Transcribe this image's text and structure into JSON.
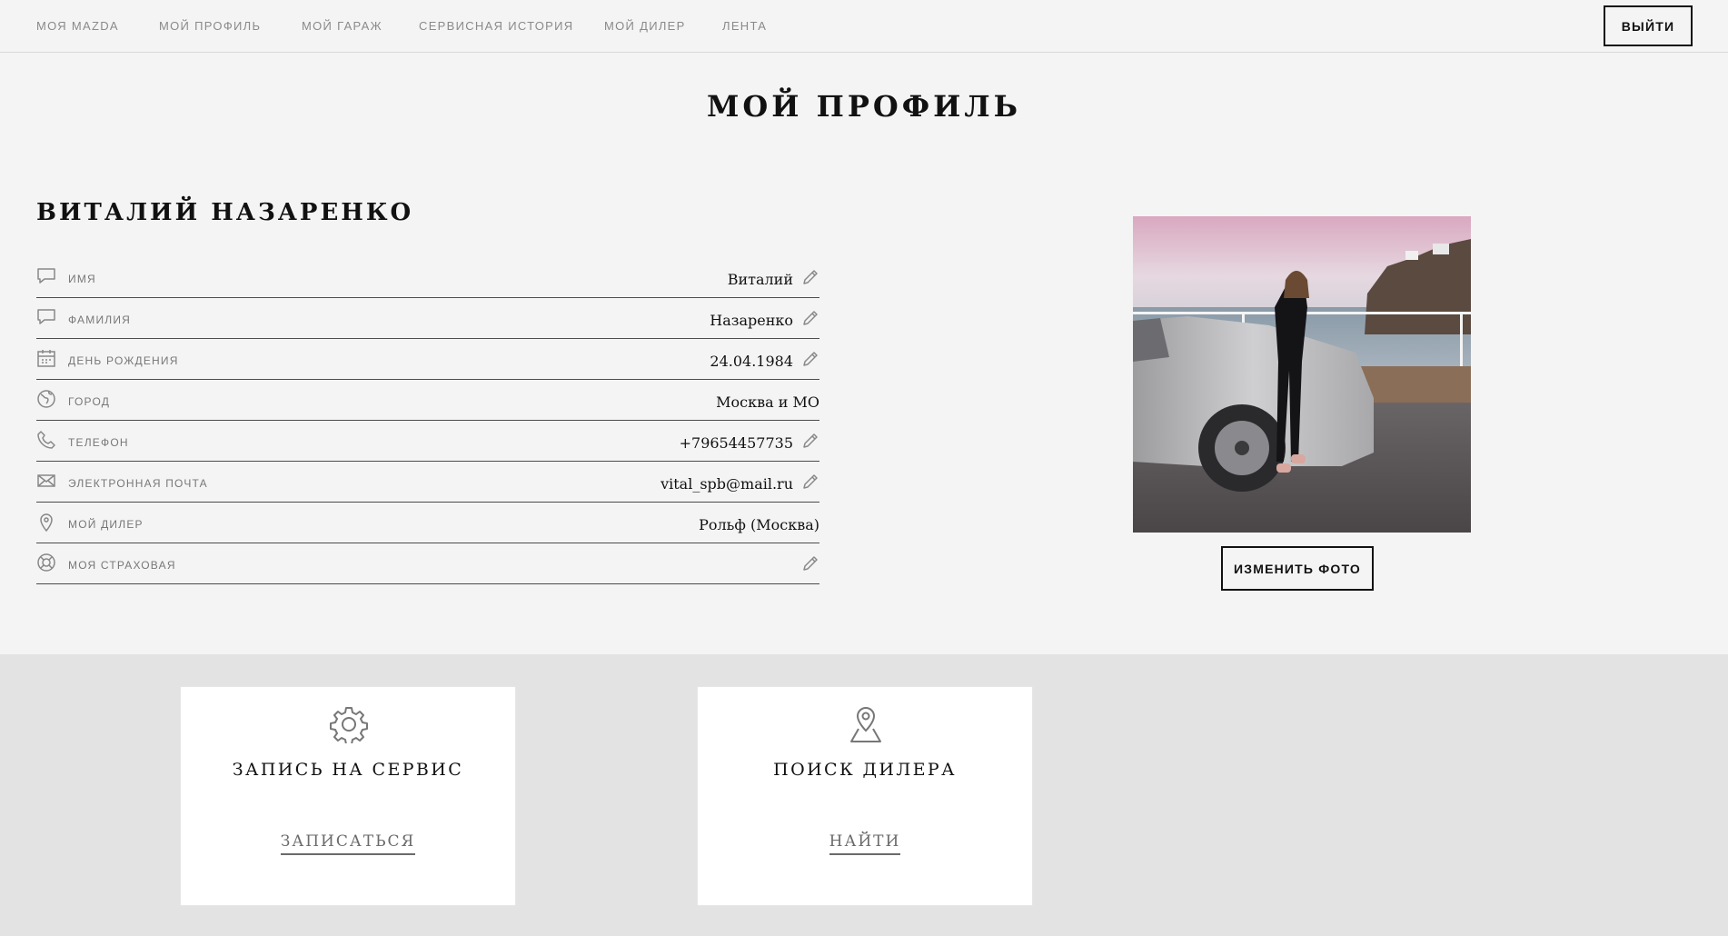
{
  "nav": {
    "items": [
      "МОЯ MAZDA",
      "МОЙ ПРОФИЛЬ",
      "МОЙ ГАРАЖ",
      "СЕРВИСНАЯ ИСТОРИЯ",
      "МОЙ ДИЛЕР",
      "ЛЕНТА"
    ],
    "logout_label": "ВЫЙТИ"
  },
  "page": {
    "title": "МОЙ ПРОФИЛЬ"
  },
  "profile": {
    "full_name": "ВИТАЛИЙ НАЗАРЕНКО",
    "fields": [
      {
        "icon": "speech-bubble-icon",
        "label": "ИМЯ",
        "value": "Виталий",
        "editable": true
      },
      {
        "icon": "speech-bubble-icon",
        "label": "ФАМИЛИЯ",
        "value": "Назаренко",
        "editable": true
      },
      {
        "icon": "calendar-icon",
        "label": "ДЕНЬ РОЖДЕНИЯ",
        "value": "24.04.1984",
        "editable": true
      },
      {
        "icon": "globe-icon",
        "label": "ГОРОД",
        "value": "Москва и МО",
        "editable": false
      },
      {
        "icon": "phone-icon",
        "label": "ТЕЛЕФОН",
        "value": "+79654457735",
        "editable": true
      },
      {
        "icon": "envelope-icon",
        "label": "ЭЛЕКТРОННАЯ ПОЧТА",
        "value": "vital_spb@mail.ru",
        "editable": true
      },
      {
        "icon": "location-pin-icon",
        "label": "МОЙ ДИЛЕР",
        "value": "Рольф (Москва)",
        "editable": false
      },
      {
        "icon": "lifebuoy-icon",
        "label": "МОЯ СТРАХОВАЯ",
        "value": "",
        "editable": true
      }
    ],
    "change_photo_label": "ИЗМЕНИТЬ ФОТО"
  },
  "cards": [
    {
      "icon": "gear-icon",
      "title": "ЗАПИСЬ НА СЕРВИС",
      "link": "ЗАПИСАТЬСЯ"
    },
    {
      "icon": "map-pin-icon",
      "title": "ПОИСК ДИЛЕРА",
      "link": "НАЙТИ"
    }
  ],
  "colors": {
    "background": "#f4f4f4",
    "bottom_section": "#e3e3e3",
    "text": "#111111",
    "muted": "#8a8a8a"
  }
}
